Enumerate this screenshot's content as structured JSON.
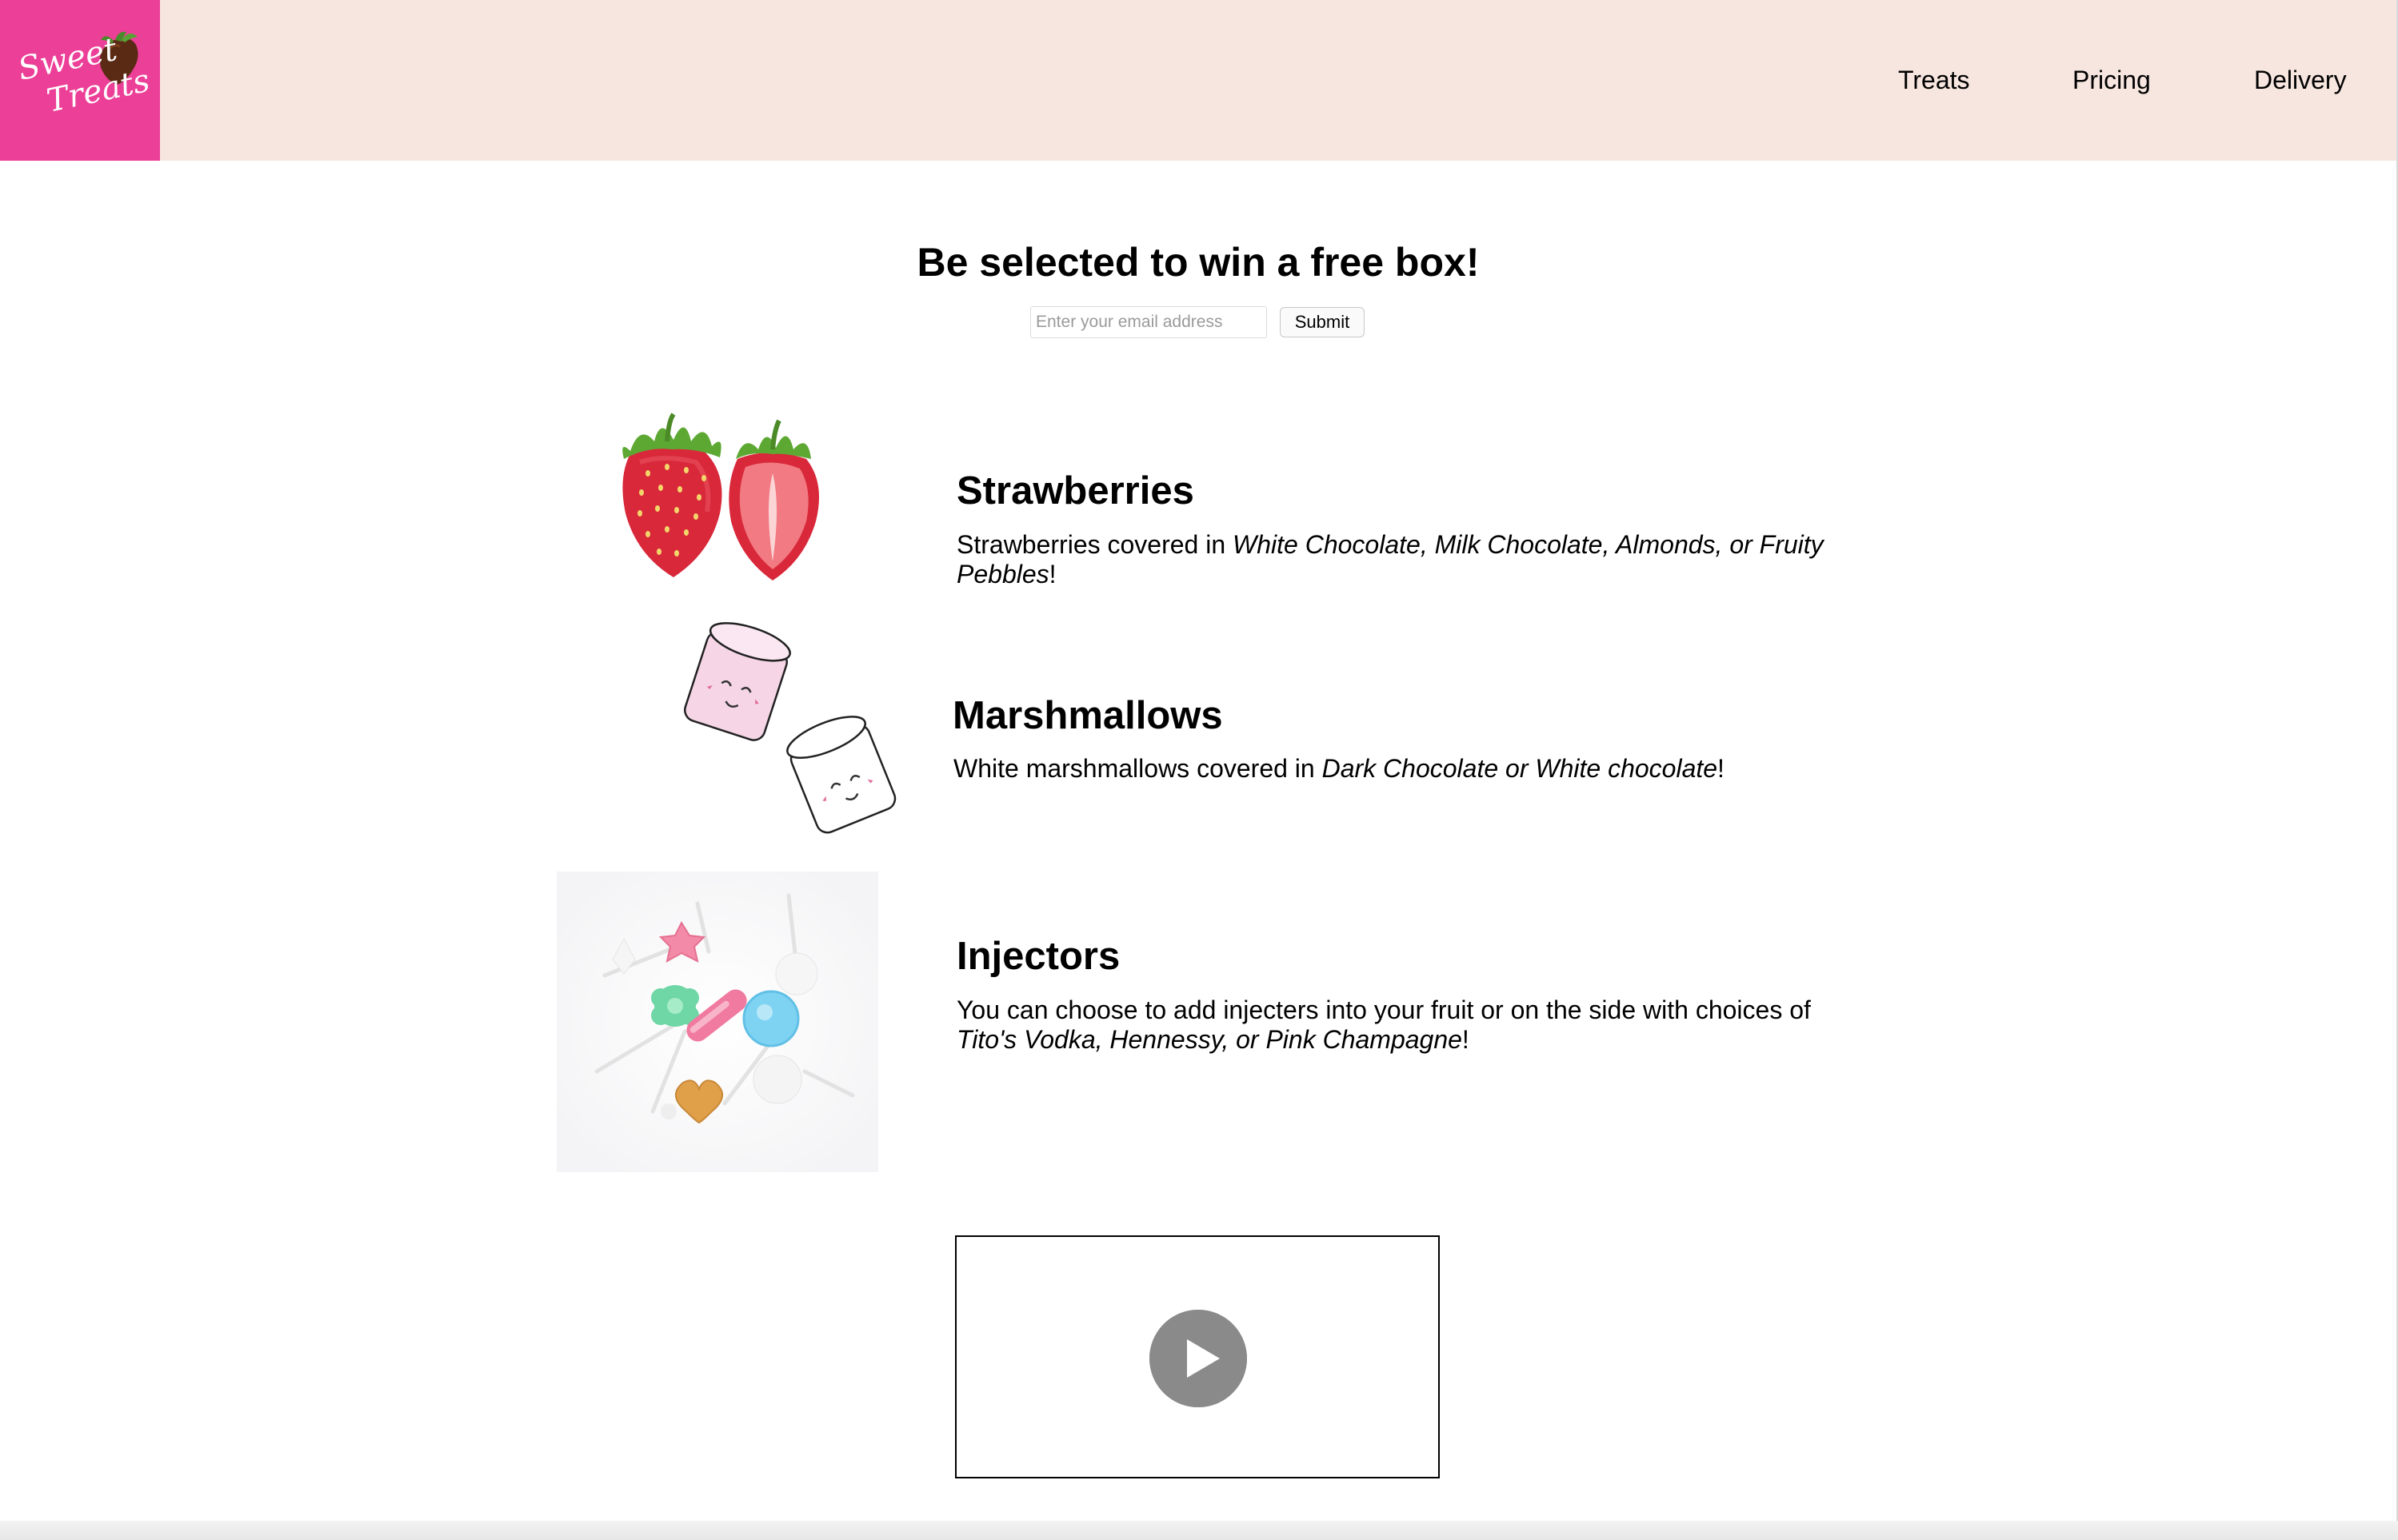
{
  "header": {
    "logo_text": [
      "Sweet",
      "Treats"
    ],
    "nav": [
      {
        "label": "Treats"
      },
      {
        "label": "Pricing"
      },
      {
        "label": "Delivery"
      }
    ],
    "colors": {
      "background": "#f7e6df",
      "logo_background": "#ec3f97"
    }
  },
  "hero": {
    "title": "Be selected to win a free box!",
    "email_placeholder": "Enter your email address",
    "submit_label": "Submit"
  },
  "products": [
    {
      "name": "Strawberries",
      "desc_prefix": "Strawberries covered in ",
      "desc_em": "White Chocolate, Milk Chocolate, Almonds, or Fruity Pebbles",
      "desc_suffix": "!",
      "image_icon": "strawberries-image"
    },
    {
      "name": "Marshmallows",
      "desc_prefix": "White marshmallows covered in ",
      "desc_em": "Dark Chocolate or White chocolate",
      "desc_suffix": "!",
      "image_icon": "marshmallows-image"
    },
    {
      "name": "Injectors",
      "desc_prefix": "You can choose to add injecters into your fruit or on the side with choices of ",
      "desc_em": "Tito's Vodka, Hennessy, or Pink Champagne",
      "desc_suffix": "!",
      "image_icon": "lollipops-image"
    }
  ],
  "video": {
    "icon": "play-icon"
  }
}
